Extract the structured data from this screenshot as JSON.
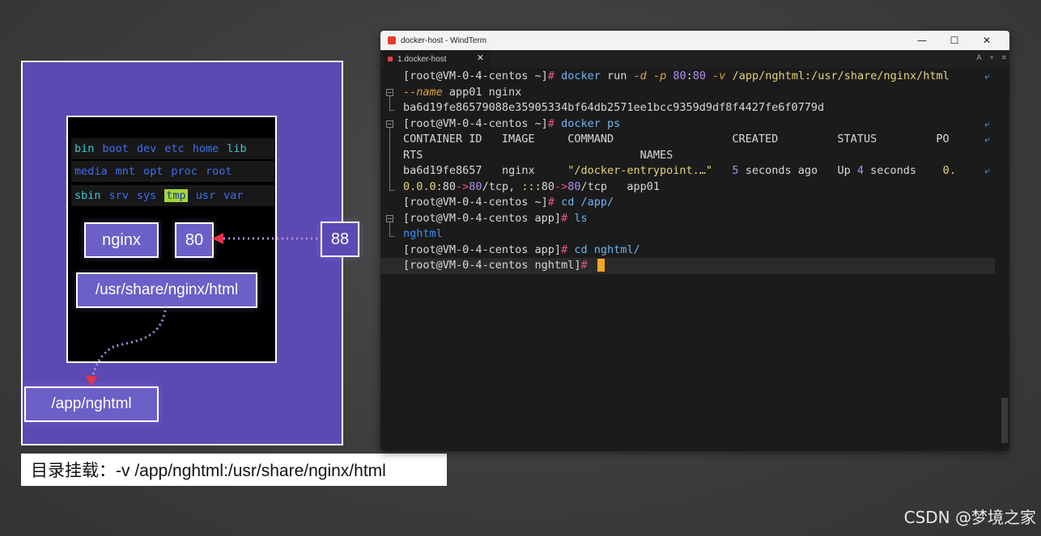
{
  "diagram": {
    "dirs": {
      "row1": [
        "bin",
        "boot",
        "dev",
        "etc",
        "home",
        "lib"
      ],
      "row2": [
        "media",
        "mnt",
        "opt",
        "proc",
        "root"
      ],
      "row3": [
        "sbin",
        "srv",
        "sys",
        "tmp",
        "usr",
        "var"
      ]
    },
    "nginx_label": "nginx",
    "container_port": "80",
    "host_port": "88",
    "container_path": "/usr/share/nginx/html",
    "host_path": "/app/nghtml",
    "caption": "目录挂载：-v /app/nghtml:/usr/share/nginx/html"
  },
  "window": {
    "title": "docker-host - WindTerm",
    "tab_label": "1.docker-host",
    "tab_close": "✕",
    "tab_actions": [
      "A",
      "+",
      "≡"
    ],
    "controls": [
      "—",
      "☐",
      "✕"
    ]
  },
  "terminal": {
    "prompt_home": "[root@VM-0-4-centos ~]",
    "prompt_app": "[root@VM-0-4-centos app]",
    "prompt_nghtml": "[root@VM-0-4-centos nghtml]",
    "hash": "#",
    "cmd1": {
      "docker": "docker",
      "run": "run",
      "d": "-d",
      "p": "-p",
      "port1": "80",
      "colon": ":",
      "port2": "80",
      "v": "-v",
      "vol": "/app/nghtml:/usr/share/nginx/html",
      "name_flag": "--name",
      "rest": " app01 nginx"
    },
    "container_id": "ba6d19fe86579088e35905334bf64db2571ee1bcc9359d9df8f4427fe6f0779d",
    "cmd2": "docker ps",
    "ps_header1": "CONTAINER ID   IMAGE     COMMAND                  CREATED         STATUS         PO",
    "ps_header2": "RTS                                 NAMES",
    "ps_row": {
      "id": "ba6d19fe8657",
      "image": "nginx",
      "command": "\"/docker-entrypoint.…\"",
      "created_num": "5",
      "created_rest": " seconds ago",
      "status_up": "Up ",
      "status_num": "4",
      "status_rest": " seconds",
      "ports_start": "0."
    },
    "ps_row2": {
      "a": "0.0.0",
      "b": ":80",
      "c": "->",
      "d": "80",
      "e": "/tcp, ",
      "f": ":::",
      "g": "80",
      "h": "->",
      "i": "80",
      "j": "/tcp   app01"
    },
    "cmd3_a": "cd",
    "cmd3_b": " /app/",
    "cmd4": "ls",
    "ls_out": "nghtml",
    "cmd5_a": "cd",
    "cmd5_b": " nghtml/",
    "wrap_glyph": "⤶"
  },
  "watermark": "CSDN @梦境之家",
  "colors": {
    "diagram_bg": "#5d49b3",
    "cursor": "#f5a623",
    "arrow": "#e8334a"
  }
}
